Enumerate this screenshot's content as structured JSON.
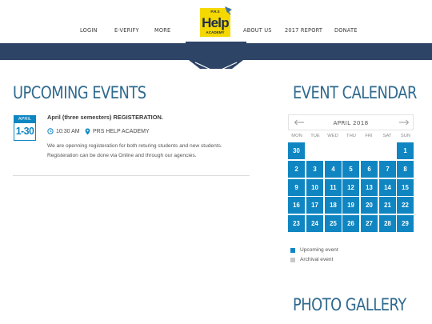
{
  "nav": {
    "left": [
      "LOGIN",
      "E-VERIFY",
      "MORE"
    ],
    "right": [
      "ABOUT US",
      "2017 REPORT",
      "DONATE"
    ]
  },
  "logo": {
    "top_text": "P.R.S",
    "main_text": "Help",
    "sub_text": "ACADEMY",
    "color": "#f5d800"
  },
  "colors": {
    "band": "#2d4466",
    "accent": "#0f86c2",
    "heading": "#2f6a8f"
  },
  "upcoming": {
    "title": "UPCOMING EVENTS",
    "event": {
      "month": "APRIL",
      "days": "1-30",
      "title": "April (three semesters) REGISTERATION.",
      "time": "10:30 AM",
      "location": "PRS HELP ACADEMY",
      "desc_line1": "We are openning registeration for both returing students and new students.",
      "desc_line2": "Registeration can be done via Online and through our agencies."
    }
  },
  "calendar": {
    "title": "EVENT CALENDAR",
    "month": "APRIL 2018",
    "weekdays": [
      "MON",
      "TUE",
      "WED",
      "THU",
      "FRI",
      "SAT",
      "SUN"
    ],
    "leading_day": "30",
    "days": [
      "1",
      "2",
      "3",
      "4",
      "5",
      "6",
      "7",
      "8",
      "9",
      "10",
      "11",
      "12",
      "13",
      "14",
      "15",
      "16",
      "17",
      "18",
      "19",
      "20",
      "21",
      "22",
      "23",
      "24",
      "25",
      "26",
      "27",
      "28",
      "29"
    ],
    "legend": {
      "upcoming": "Upcoming event",
      "archival": "Archival event",
      "upcoming_color": "#0f86c2",
      "archival_color": "#c8c8c8"
    }
  },
  "gallery": {
    "title": "PHOTO GALLERY"
  }
}
